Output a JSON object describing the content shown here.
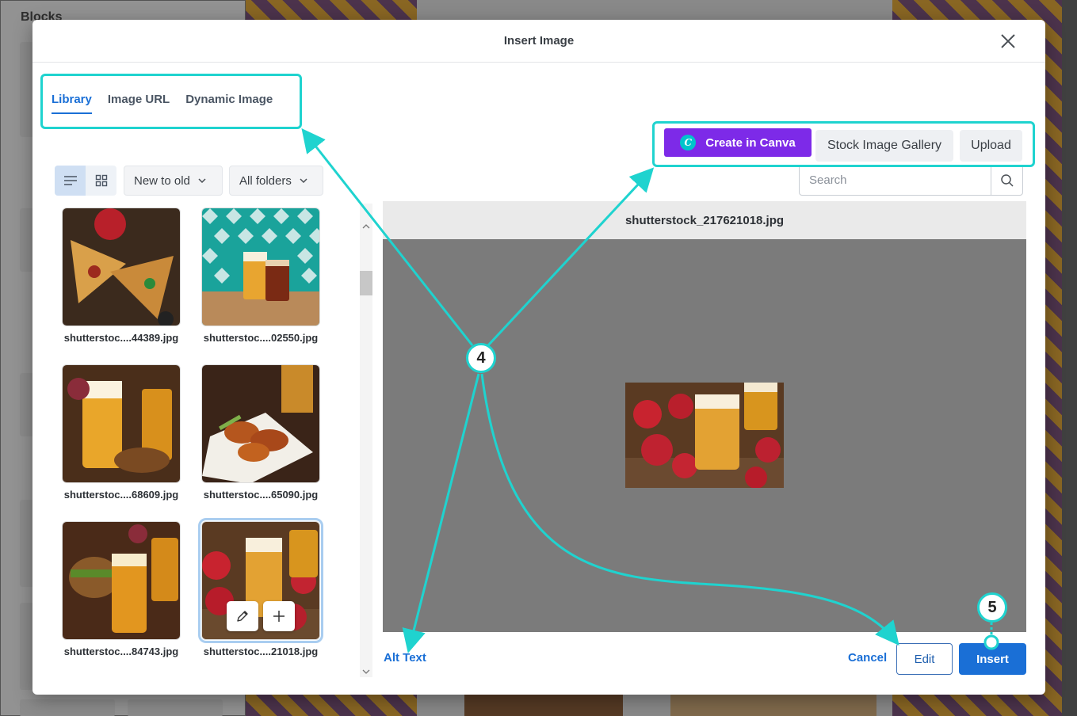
{
  "background": {
    "panel_title": "Blocks"
  },
  "modal": {
    "title": "Insert Image",
    "tabs": [
      {
        "label": "Library",
        "active": true
      },
      {
        "label": "Image URL",
        "active": false
      },
      {
        "label": "Dynamic Image",
        "active": false
      }
    ],
    "sort": {
      "selected": "New to old"
    },
    "folder": {
      "selected": "All folders"
    },
    "actions": {
      "canva_label": "Create in Canva",
      "stock_label": "Stock Image Gallery",
      "upload_label": "Upload"
    },
    "search": {
      "placeholder": "Search",
      "value": ""
    },
    "images": [
      {
        "name": "shutterstoc....44389.jpg",
        "selected": false
      },
      {
        "name": "shutterstoc....02550.jpg",
        "selected": false
      },
      {
        "name": "shutterstoc....68609.jpg",
        "selected": false
      },
      {
        "name": "shutterstoc....65090.jpg",
        "selected": false
      },
      {
        "name": "shutterstoc....84743.jpg",
        "selected": false
      },
      {
        "name": "shutterstoc....21018.jpg",
        "selected": true
      }
    ],
    "preview": {
      "filename": "shutterstock_217621018.jpg"
    },
    "footer": {
      "alt_text_label": "Alt Text",
      "cancel_label": "Cancel",
      "edit_label": "Edit",
      "insert_label": "Insert"
    }
  },
  "annotations": {
    "badge_4": "4",
    "badge_5": "5",
    "color": "#1fd3cf"
  },
  "colors": {
    "accent": "#1a6fd6",
    "canva": "#7d2ae8"
  }
}
